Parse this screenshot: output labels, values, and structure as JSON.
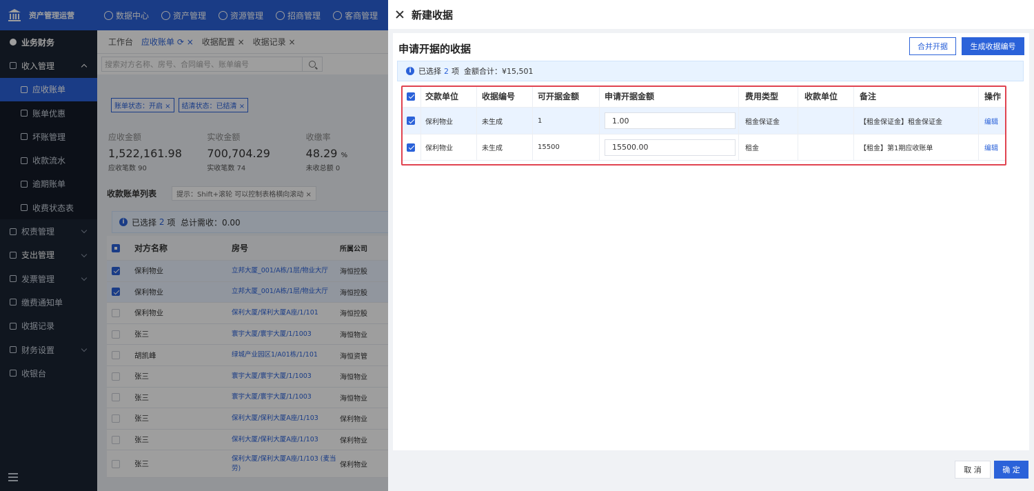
{
  "app": {
    "title": "资产管理运营"
  },
  "topnav": [
    "数据中心",
    "资产管理",
    "资源管理",
    "招商管理",
    "客商管理"
  ],
  "sidebar": {
    "items": [
      {
        "label": "业务财务"
      },
      {
        "label": "收入管理"
      },
      {
        "label": "应收账单"
      },
      {
        "label": "账单优惠"
      },
      {
        "label": "坏账管理"
      },
      {
        "label": "收款流水"
      },
      {
        "label": "逾期账单"
      },
      {
        "label": "收费状态表"
      },
      {
        "label": "权责管理"
      },
      {
        "label": "支出管理"
      },
      {
        "label": "发票管理"
      },
      {
        "label": "缴费通知单"
      },
      {
        "label": "收据记录"
      },
      {
        "label": "财务设置"
      },
      {
        "label": "收银台"
      }
    ]
  },
  "tabs": [
    "工作台",
    "应收账单",
    "收据配置",
    "收据记录"
  ],
  "search": {
    "placeholder": "搜索对方名称、房号、合同编号、账单编号"
  },
  "filters": [
    "账单状态：开启 ×",
    "结清状态：已结清 ×"
  ],
  "stats": [
    {
      "label": "应收金额",
      "value": "1,522,161.98",
      "sub": "应收笔数 90"
    },
    {
      "label": "实收金额",
      "value": "700,704.29",
      "sub": "实收笔数 74"
    },
    {
      "label": "收缴率",
      "value": "48.29",
      "unit": "%",
      "sub": "未收总额 0"
    }
  ],
  "list": {
    "title": "收款账单列表",
    "hint": "提示：Shift+滚轮 可以控制表格横向滚动  ×",
    "selected_prefix": "已选择",
    "selected_count": "2",
    "selected_suffix": "项",
    "total_label": "总计需收：0.00",
    "columns": [
      "对方名称",
      "房号",
      "所属公司"
    ],
    "rows": [
      {
        "name": "保利物业",
        "room": "立邦大厦_001/A栋/1层/物业大厅",
        "company": "海恒控股",
        "checked": true
      },
      {
        "name": "保利物业",
        "room": "立邦大厦_001/A栋/1层/物业大厅",
        "company": "海恒控股",
        "checked": true
      },
      {
        "name": "保利物业",
        "room": "保利大厦/保利大厦A座/1/101",
        "company": "海恒控股",
        "checked": false
      },
      {
        "name": "张三",
        "room": "寰宇大厦/寰宇大厦/1/1003",
        "company": "海恒物业",
        "checked": false
      },
      {
        "name": "胡凯峰",
        "room": "绿城产业园区1/A01栋/1/101",
        "company": "海恒资管",
        "checked": false
      },
      {
        "name": "张三",
        "room": "寰宇大厦/寰宇大厦/1/1003",
        "company": "海恒物业",
        "checked": false
      },
      {
        "name": "张三",
        "room": "寰宇大厦/寰宇大厦/1/1003",
        "company": "海恒物业",
        "checked": false
      },
      {
        "name": "张三",
        "room": "保利大厦/保利大厦A座/1/103",
        "company": "保利物业",
        "checked": false
      },
      {
        "name": "张三",
        "room": "保利大厦/保利大厦A座/1/103",
        "company": "保利物业",
        "checked": false
      },
      {
        "name": "张三",
        "room": "保利大厦/保利大厦A座/1/103 (麦当劳)",
        "company": "保利物业",
        "checked": false
      }
    ]
  },
  "drawer": {
    "title": "新建收据",
    "card_title": "申请开据的收据",
    "merge_button": "合并开据",
    "generate_button": "生成收据编号",
    "info": {
      "prefix": "已选择",
      "count": "2",
      "suffix": "项",
      "total": "金额合计：¥15,501"
    },
    "columns": [
      "交款单位",
      "收据编号",
      "可开据金额",
      "申请开据金额",
      "费用类型",
      "收款单位",
      "备注",
      "操作"
    ],
    "rows": [
      {
        "payer": "保利物业",
        "receipt_no": "未生成",
        "available": "1",
        "apply": "1.00",
        "fee_type": "租金保证金",
        "payee": "",
        "remark": "【租金保证金】租金保证金",
        "action": "编辑"
      },
      {
        "payer": "保利物业",
        "receipt_no": "未生成",
        "available": "15500",
        "apply": "15500.00",
        "fee_type": "租金",
        "payee": "",
        "remark": "【租金】第1期应收账单",
        "action": "编辑"
      }
    ],
    "cancel_button": "取 消",
    "confirm_button": "确 定"
  },
  "colors": {
    "primary": "#2b62d9",
    "sidebar": "#1b2433",
    "highlight": "#e0424f"
  }
}
